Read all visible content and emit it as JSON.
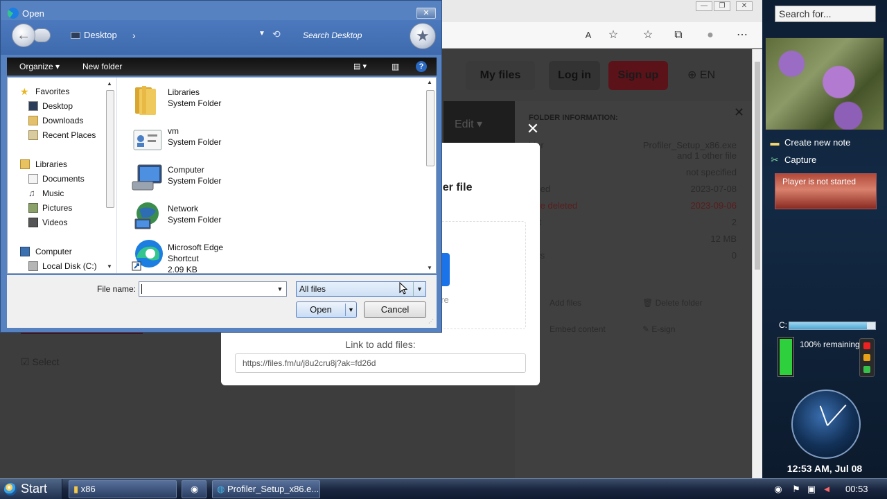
{
  "browser": {
    "window_controls": [
      "—",
      "❐",
      "✕"
    ],
    "nav": {
      "my_files": "My files",
      "log_in": "Log in",
      "sign_up": "Sign up",
      "language": "EN"
    },
    "edit_label": "Edit",
    "folder_info": {
      "header": "FOLDER INFORMATION:",
      "rows": [
        {
          "label": "lder",
          "value": "Profiler_Setup_x86.exe",
          "value2": "and 1 other file",
          "red": false
        },
        {
          "label": "er",
          "value": "not specified",
          "red": false
        },
        {
          "label": "dified",
          "value": "2023-07-08",
          "red": false
        },
        {
          "label": "ll be deleted",
          "value": "2023-09-06",
          "red": true
        },
        {
          "label": "unt",
          "value": "2",
          "red": false
        },
        {
          "label": "e",
          "value": "12 MB",
          "red": false
        },
        {
          "label": "ews",
          "value": "0",
          "red": false
        }
      ],
      "actions": [
        "Add files",
        "Delete folder",
        "Embed content",
        "E-sign"
      ]
    },
    "select_label": "Select",
    "upload_modal": {
      "other_file_text": "her file",
      "here_text": "ere",
      "link_label": "Link to add files:",
      "link_value": "https://files.fm/u/j8u2cru8j?ak=fd26d"
    }
  },
  "sidebar": {
    "search_placeholder": "Search for...",
    "notes": [
      {
        "label": "Create new note",
        "icon": "note-icon"
      },
      {
        "label": "Capture",
        "icon": "scissors-icon"
      }
    ],
    "player_status": "Player is not started",
    "drive_label": "C:",
    "drive_used_fraction": 0.9,
    "battery_text": "100% remaining",
    "battery_level": 1.0,
    "clock_display": "12:53 AM, Jul 08"
  },
  "dialog": {
    "title": "Open",
    "close_glyph": "✕",
    "location": "Desktop",
    "search_placeholder": "Search Desktop",
    "toolbar": {
      "organize": "Organize",
      "new_folder": "New folder",
      "help": "?"
    },
    "nav_pane": {
      "groups": [
        {
          "label": "Favorites",
          "icon": "star-icon",
          "items": [
            {
              "label": "Desktop",
              "icon": "desktop-icon"
            },
            {
              "label": "Downloads",
              "icon": "downloads-icon"
            },
            {
              "label": "Recent Places",
              "icon": "recent-places-icon"
            }
          ]
        },
        {
          "label": "Libraries",
          "icon": "libraries-icon",
          "items": [
            {
              "label": "Documents",
              "icon": "documents-icon"
            },
            {
              "label": "Music",
              "icon": "music-icon"
            },
            {
              "label": "Pictures",
              "icon": "pictures-icon"
            },
            {
              "label": "Videos",
              "icon": "videos-icon"
            }
          ]
        },
        {
          "label": "Computer",
          "icon": "computer-icon",
          "items": [
            {
              "label": "Local Disk (C:)",
              "icon": "local-disk-icon"
            }
          ]
        }
      ]
    },
    "files": [
      {
        "name": "Libraries",
        "type": "System Folder",
        "icon": "libraries-folder-icon"
      },
      {
        "name": "vm",
        "type": "System Folder",
        "icon": "user-folder-icon"
      },
      {
        "name": "Computer",
        "type": "System Folder",
        "icon": "computer-icon"
      },
      {
        "name": "Network",
        "type": "System Folder",
        "icon": "network-icon"
      },
      {
        "name": "Microsoft Edge",
        "type": "Shortcut",
        "size": "2.09 KB",
        "icon": "edge-icon"
      }
    ],
    "file_name_label": "File name:",
    "file_name_value": "",
    "file_type": "All files",
    "open_label": "Open",
    "cancel_label": "Cancel"
  },
  "taskbar": {
    "start_label": "Start",
    "tasks": [
      {
        "label": "x86",
        "icon": "folder-icon"
      },
      {
        "label": "Profiler_Setup_x86.e...",
        "icon": "edge-icon"
      }
    ],
    "clock": "00:53"
  },
  "colors": {
    "dialog_frame": "#5782c1",
    "accent_blue": "#1a73e8",
    "sign_up_red": "#5b1219",
    "battery_green": "#2ed13d"
  }
}
